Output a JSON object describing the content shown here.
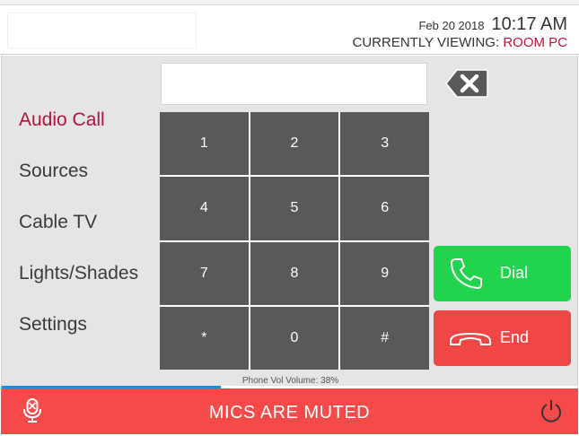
{
  "header": {
    "date": "Feb 20 2018",
    "time": "10:17 AM",
    "viewing_label": "CURRENTLY VIEWING:",
    "viewing_room": "ROOM PC"
  },
  "nav": {
    "items": [
      {
        "label": "Audio Call",
        "active": true
      },
      {
        "label": "Sources",
        "active": false
      },
      {
        "label": "Cable TV",
        "active": false
      },
      {
        "label": "Lights/Shades",
        "active": false
      },
      {
        "label": "Settings",
        "active": false
      }
    ]
  },
  "dialer": {
    "display_value": "",
    "keys": [
      "1",
      "2",
      "3",
      "4",
      "5",
      "6",
      "7",
      "8",
      "9",
      "*",
      "0",
      "#"
    ],
    "dial_label": "Dial",
    "end_label": "End",
    "icons": {
      "backspace": "backspace-icon",
      "dial": "phone-icon",
      "end": "hangup-icon"
    }
  },
  "volume": {
    "label": "Phone Vol Volume: 38%",
    "percent": 38
  },
  "footer": {
    "mute_text": "MICS ARE MUTED",
    "icons": {
      "mic": "mic-muted-icon",
      "power": "power-icon"
    }
  },
  "colors": {
    "accent": "#b3133f",
    "dial": "#22d44d",
    "end": "#f04646",
    "footer": "#f64a4a",
    "keypad": "#595959",
    "volume": "#1a8fe0"
  }
}
